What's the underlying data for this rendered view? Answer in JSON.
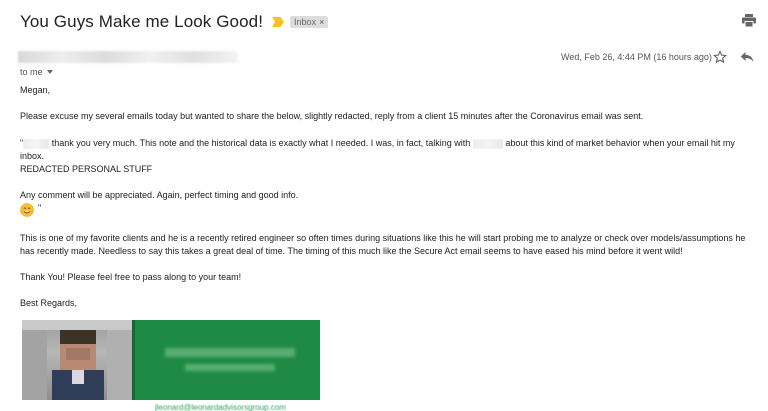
{
  "email": {
    "subject": "You Guys Make me Look Good!",
    "label": "Inbox",
    "label_remove": "×",
    "recipient": "to me",
    "date": "Wed, Feb 26, 4:44 PM (16 hours ago)"
  },
  "body": {
    "greeting": "Megan,",
    "p1": "Please excuse my several emails today but wanted to share the below, slightly redacted, reply from a client 15 minutes after the Coronavirus email was sent.",
    "quote_open": "\"",
    "quote_part1": "thank you very much.  This note and the historical data is exactly what I needed.  I was, in fact, talking with",
    "quote_part2": "about this kind of market behavior when your email hit my inbox.",
    "redacted": "REDACTED PERSONAL STUFF",
    "comment": "Any comment will be appreciated.  Again, perfect timing and good info.",
    "quote_close": "\"",
    "p2": "This is one of my favorite clients and he is a recently retired engineer so often times during situations like this he will start probing me to analyze or check over models/assumptions he has recently made.  Needless to say this takes a great deal of time.  The timing of this much like the Secure Act email seems to have eased his mind before it went wild!",
    "thanks": "Thank You!  Please feel free to pass along to your team!",
    "closing": "Best Regards,"
  },
  "signature": {
    "link": "jleonard@leonardadvisorsgroup.com"
  },
  "icons": {
    "print": "print-icon",
    "star": "star-icon",
    "reply": "reply-icon",
    "importance": "importance-marker-icon",
    "emoji": "smiling-face-emoji"
  },
  "colors": {
    "importance": "#f6c026",
    "banner": "#1e8a43",
    "link": "#33a060"
  }
}
